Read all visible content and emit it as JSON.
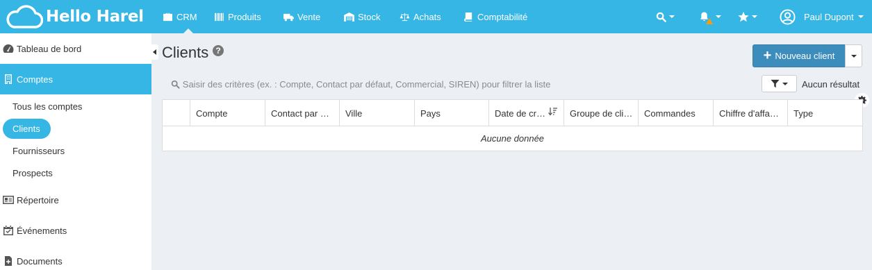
{
  "app": {
    "name": "Hello Harel"
  },
  "topnav": {
    "items": [
      {
        "label": "CRM",
        "icon": "briefcase-icon",
        "active": true
      },
      {
        "label": "Produits",
        "icon": "barcode-icon"
      },
      {
        "label": "Vente",
        "icon": "truck-icon"
      },
      {
        "label": "Stock",
        "icon": "warehouse-icon"
      },
      {
        "label": "Achats",
        "icon": "scale-icon"
      },
      {
        "label": "Comptabilité",
        "icon": "book-icon"
      }
    ],
    "user": "Paul Dupont"
  },
  "sidebar": {
    "items": [
      {
        "label": "Tableau de bord",
        "icon": "dashboard-icon"
      },
      {
        "label": "Comptes",
        "icon": "building-icon",
        "active": true
      },
      {
        "label": "Répertoire",
        "icon": "address-card-icon"
      },
      {
        "label": "Événements",
        "icon": "calendar-check-icon"
      },
      {
        "label": "Documents",
        "icon": "file-plus-icon"
      }
    ],
    "subitems": [
      {
        "label": "Tous les comptes"
      },
      {
        "label": "Clients",
        "active": true
      },
      {
        "label": "Fournisseurs"
      },
      {
        "label": "Prospects"
      }
    ]
  },
  "main": {
    "title": "Clients",
    "new_button": "Nouveau client",
    "search_placeholder": "Saisir des critères (ex. : Compte, Contact par défaut, Commercial, SIREN) pour filtrer la liste",
    "result_count": "Aucun résultat",
    "columns": [
      "Compte",
      "Contact par défaut",
      "Ville",
      "Pays",
      "Date de création",
      "Groupe de clients",
      "Commandes",
      "Chiffre d'affaires",
      "Type"
    ],
    "columns_display": [
      "Compte",
      "Contact par …",
      "Ville",
      "Pays",
      "Date de cr…",
      "Groupe de cli…",
      "Commandes",
      "Chiffre d'affa…",
      "Type"
    ],
    "empty_text": "Aucune donnée"
  },
  "colors": {
    "brand": "#35b6e5",
    "primary_button": "#3c8dbc",
    "background": "#ecf0f5"
  }
}
